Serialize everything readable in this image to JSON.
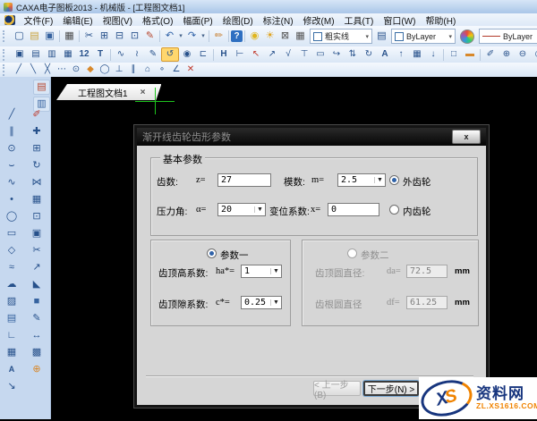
{
  "window": {
    "title": "CAXA电子图板2013 - 机械版 - [工程图文档1]"
  },
  "menu": [
    "文件(F)",
    "编辑(E)",
    "视图(V)",
    "格式(O)",
    "幅面(P)",
    "绘图(D)",
    "标注(N)",
    "修改(M)",
    "工具(T)",
    "窗口(W)",
    "帮助(H)"
  ],
  "tab": {
    "label": "工程图文档1",
    "close": "×"
  },
  "tb1": {
    "icons_a": [
      {
        "n": "new-file-icon",
        "g": "▢"
      },
      {
        "n": "open-file-icon",
        "g": "▤",
        "c": "#c8a13a"
      },
      {
        "n": "save-file-icon",
        "g": "▣",
        "c": "#35629f"
      },
      {
        "sep": 1
      },
      {
        "n": "print-icon",
        "g": "▦",
        "c": "#4a4a4a"
      },
      {
        "sep": 1
      },
      {
        "n": "cut-icon",
        "g": "✂"
      },
      {
        "n": "copy-icon",
        "g": "⊞"
      },
      {
        "n": "paste-preview-icon",
        "g": "⊟"
      },
      {
        "n": "paste-icon",
        "g": "⊡"
      },
      {
        "n": "format-brush-icon",
        "g": "✎",
        "c": "#b6452c"
      },
      {
        "sep": 1
      },
      {
        "n": "undo-icon",
        "g": "↶",
        "c": "#2f62a8"
      },
      {
        "n": "undo-dropdown-icon",
        "g": "▾",
        "cls": "dd"
      },
      {
        "n": "redo-icon",
        "g": "↷",
        "c": "#2f62a8"
      },
      {
        "n": "redo-dropdown-icon",
        "g": "▾",
        "cls": "dd"
      },
      {
        "sep": 1
      },
      {
        "n": "edit-check-icon",
        "g": "✏",
        "c": "#c87f2f"
      },
      {
        "sep": 1
      },
      {
        "n": "help-icon",
        "g": "?",
        "cls": "helpicon"
      },
      {
        "sep": 1
      },
      {
        "n": "layer-bulb-icon",
        "g": "◉",
        "c": "#e0b61f"
      },
      {
        "n": "brightness-icon",
        "g": "☀",
        "c": "#e0a31f"
      },
      {
        "n": "layer-lock-icon",
        "g": "⊠",
        "c": "#555555"
      },
      {
        "n": "layer-print-icon",
        "g": "▦",
        "c": "#555555"
      }
    ],
    "linetype_combo": {
      "label": "粗实线",
      "arrow": "▾"
    },
    "layers_glyph": "▤",
    "color_combo": {
      "label": "ByLayer",
      "arrow": "▾"
    },
    "linestyle_combo": {
      "label": "ByLayer",
      "arrow": "▾"
    },
    "linewidth_glyph": "≡"
  },
  "tb2": [
    {
      "n": "window-cascade-icon",
      "g": "▣"
    },
    {
      "n": "window-tile-icon",
      "g": "▤"
    },
    {
      "n": "frame-load-icon",
      "g": "▥"
    },
    {
      "n": "grid-display-icon",
      "g": "▦"
    },
    {
      "n": "two-window-icon",
      "g": "12",
      "cls": "txt"
    },
    {
      "n": "bom-table-icon",
      "g": "T",
      "cls": "txt"
    },
    {
      "sep": 1
    },
    {
      "n": "wave-line-icon",
      "g": "∿"
    },
    {
      "n": "zigzag-line-icon",
      "g": "≀"
    },
    {
      "n": "sketch-pencil-icon",
      "g": "✎"
    },
    {
      "n": "orbit-tool-icon",
      "g": "↺",
      "cls": "active-tool"
    },
    {
      "n": "zoom-object-icon",
      "g": "◉"
    },
    {
      "n": "connector-icon",
      "g": "⊏"
    },
    {
      "sep": 1
    },
    {
      "n": "dim-horizontal-icon",
      "g": "H",
      "cls": "txt"
    },
    {
      "n": "dim-smart-icon",
      "g": "⊢"
    },
    {
      "n": "leader-red-icon",
      "g": "↖",
      "c": "#c0392b"
    },
    {
      "n": "leader-arrow-icon",
      "g": "↗"
    },
    {
      "n": "check-mark-icon",
      "g": "√"
    },
    {
      "n": "datum-symbol-icon",
      "g": "⊤"
    },
    {
      "n": "raster-image-icon",
      "g": "▭"
    },
    {
      "n": "arc-arrow-icon",
      "g": "↪"
    },
    {
      "n": "scale-tool-icon",
      "g": "⇅"
    },
    {
      "n": "rotate-tool-icon",
      "g": "↻"
    },
    {
      "n": "text-style-icon",
      "g": "A",
      "cls": "txt"
    },
    {
      "n": "move-up-icon",
      "g": "↑"
    },
    {
      "n": "block-grid-icon",
      "g": "▦"
    },
    {
      "n": "move-down-icon",
      "g": "↓"
    },
    {
      "sep": 1
    },
    {
      "n": "monitor-view-icon",
      "g": "□"
    },
    {
      "n": "ruler-tool-icon",
      "g": "▬",
      "c": "#d8882a"
    },
    {
      "sep": 1
    },
    {
      "n": "mark-edit-icon",
      "g": "✐"
    },
    {
      "n": "zoom-in-icon",
      "g": "⊕"
    },
    {
      "n": "zoom-out-icon",
      "g": "⊖"
    },
    {
      "n": "zoom-pan-icon",
      "g": "◎"
    }
  ],
  "tb3": [
    {
      "n": "snap-endpoint-icon",
      "g": "╱"
    },
    {
      "n": "snap-midpoint-icon",
      "g": "╲"
    },
    {
      "n": "snap-intersection-icon",
      "g": "╳"
    },
    {
      "n": "snap-dash-icon",
      "g": "⋯"
    },
    {
      "n": "snap-center-icon",
      "g": "⊙"
    },
    {
      "n": "snap-grid-icon",
      "g": "◆",
      "c": "#d8882a"
    },
    {
      "n": "snap-tangent-icon",
      "g": "◯"
    },
    {
      "n": "snap-perpendicular-icon",
      "g": "⊥"
    },
    {
      "n": "snap-parallel-icon",
      "g": "∥"
    },
    {
      "n": "snap-symmetry-icon",
      "g": "⌂"
    },
    {
      "n": "snap-node-icon",
      "g": "∘"
    },
    {
      "n": "snap-angle-icon",
      "g": "∠"
    },
    {
      "n": "snap-nearest-icon",
      "g": "✕",
      "c": "#c0392b"
    }
  ],
  "left_top": [
    {
      "n": "sheet-settings-icon",
      "g": "▤",
      "c": "#b6452c"
    },
    {
      "n": "frame-settings-icon",
      "g": "▥",
      "c": "#35629f"
    }
  ],
  "left_draw": [
    {
      "n": "draw-line-icon",
      "g": "╱"
    },
    {
      "n": "draw-parallel-icon",
      "g": "∥"
    },
    {
      "n": "draw-circle-icon",
      "g": "⊙"
    },
    {
      "n": "draw-arc-icon",
      "g": "⌣"
    },
    {
      "n": "draw-spline-icon",
      "g": "∿"
    },
    {
      "n": "draw-point-icon",
      "g": "•"
    },
    {
      "n": "draw-ellipse-icon",
      "g": "◯"
    },
    {
      "n": "draw-rectangle-icon",
      "g": "▭"
    },
    {
      "n": "draw-polygon-icon",
      "g": "◇"
    },
    {
      "n": "draw-wave-icon",
      "g": "≈"
    },
    {
      "n": "draw-cloud-icon",
      "g": "☁"
    },
    {
      "n": "draw-hatch-icon",
      "g": "▨"
    },
    {
      "n": "draw-stamp-icon",
      "g": "▤",
      "c": "#35629f"
    },
    {
      "n": "draw-angle-icon",
      "g": "∟"
    },
    {
      "n": "draw-grid-icon",
      "g": "▦"
    },
    {
      "n": "draw-text-icon",
      "g": "A",
      "cls": "txt"
    },
    {
      "n": "draw-leader-icon",
      "g": "↘"
    }
  ],
  "left_modify": [
    {
      "n": "modify-erase-icon",
      "g": "✐",
      "c": "#c0392b"
    },
    {
      "n": "modify-move-icon",
      "g": "✚"
    },
    {
      "n": "modify-copy-icon",
      "g": "⊞"
    },
    {
      "n": "modify-rotate-icon",
      "g": "↻"
    },
    {
      "n": "modify-mirror-icon",
      "g": "⋈"
    },
    {
      "n": "modify-array-icon",
      "g": "▦"
    },
    {
      "n": "modify-offset-icon",
      "g": "⊡"
    },
    {
      "n": "modify-paste-icon",
      "g": "▣"
    },
    {
      "n": "modify-trim-icon",
      "g": "✂"
    },
    {
      "n": "modify-extend-icon",
      "g": "↗"
    },
    {
      "n": "modify-chamfer-icon",
      "g": "◣"
    },
    {
      "n": "modify-block-icon",
      "g": "■",
      "c": "#35629f"
    },
    {
      "n": "modify-dim-icon",
      "g": "✎"
    },
    {
      "n": "modify-stretch-icon",
      "g": "↔"
    },
    {
      "n": "modify-props-icon",
      "g": "▩"
    },
    {
      "n": "modify-tools-icon",
      "g": "⊕",
      "c": "#d8882a"
    }
  ],
  "dialog": {
    "title": "渐开线齿轮齿形参数",
    "close_label": "x",
    "basic_group_label": "基本参数",
    "teeth_label": "齿数:",
    "teeth_sym": "z=",
    "teeth_value": "27",
    "module_label": "模数:",
    "module_sym": "m=",
    "module_value": "2.5",
    "external_radio_label": "外齿轮",
    "internal_radio_label": "内齿轮",
    "pressure_label": "压力角:",
    "pressure_sym": "α=",
    "pressure_value": "20",
    "shift_label": "变位系数:",
    "shift_sym": "x=",
    "shift_value": "0",
    "param1_radio_label": "参数一",
    "addendum_label": "齿顶高系数:",
    "addendum_sym": "ha*=",
    "addendum_value": "1",
    "clearance_label": "齿顶隙系数:",
    "clearance_sym": "c*=",
    "clearance_value": "0.25",
    "param2_radio_label": "参数二",
    "tip_label": "齿顶圆直径:",
    "tip_sym": "da=",
    "tip_value": "72.5",
    "tip_unit": "mm",
    "root_label": "齿根圆直径",
    "root_sym": "df=",
    "root_value": "61.25",
    "root_unit": "mm",
    "back_button": "< 上一步(B)",
    "next_button": "下一步(N) >"
  },
  "watermark": {
    "logo_x": "X",
    "logo_s": "S",
    "site_name": "资料网",
    "site_url": "ZL.XS1616.COM"
  },
  "colors": {
    "crosshair_green": "#1ec41e",
    "dialog_titlebar": "#2a2a2a",
    "watermark_navy": "#17357e",
    "watermark_orange": "#f08300",
    "toolbar_blue": "#d9e6f5"
  }
}
